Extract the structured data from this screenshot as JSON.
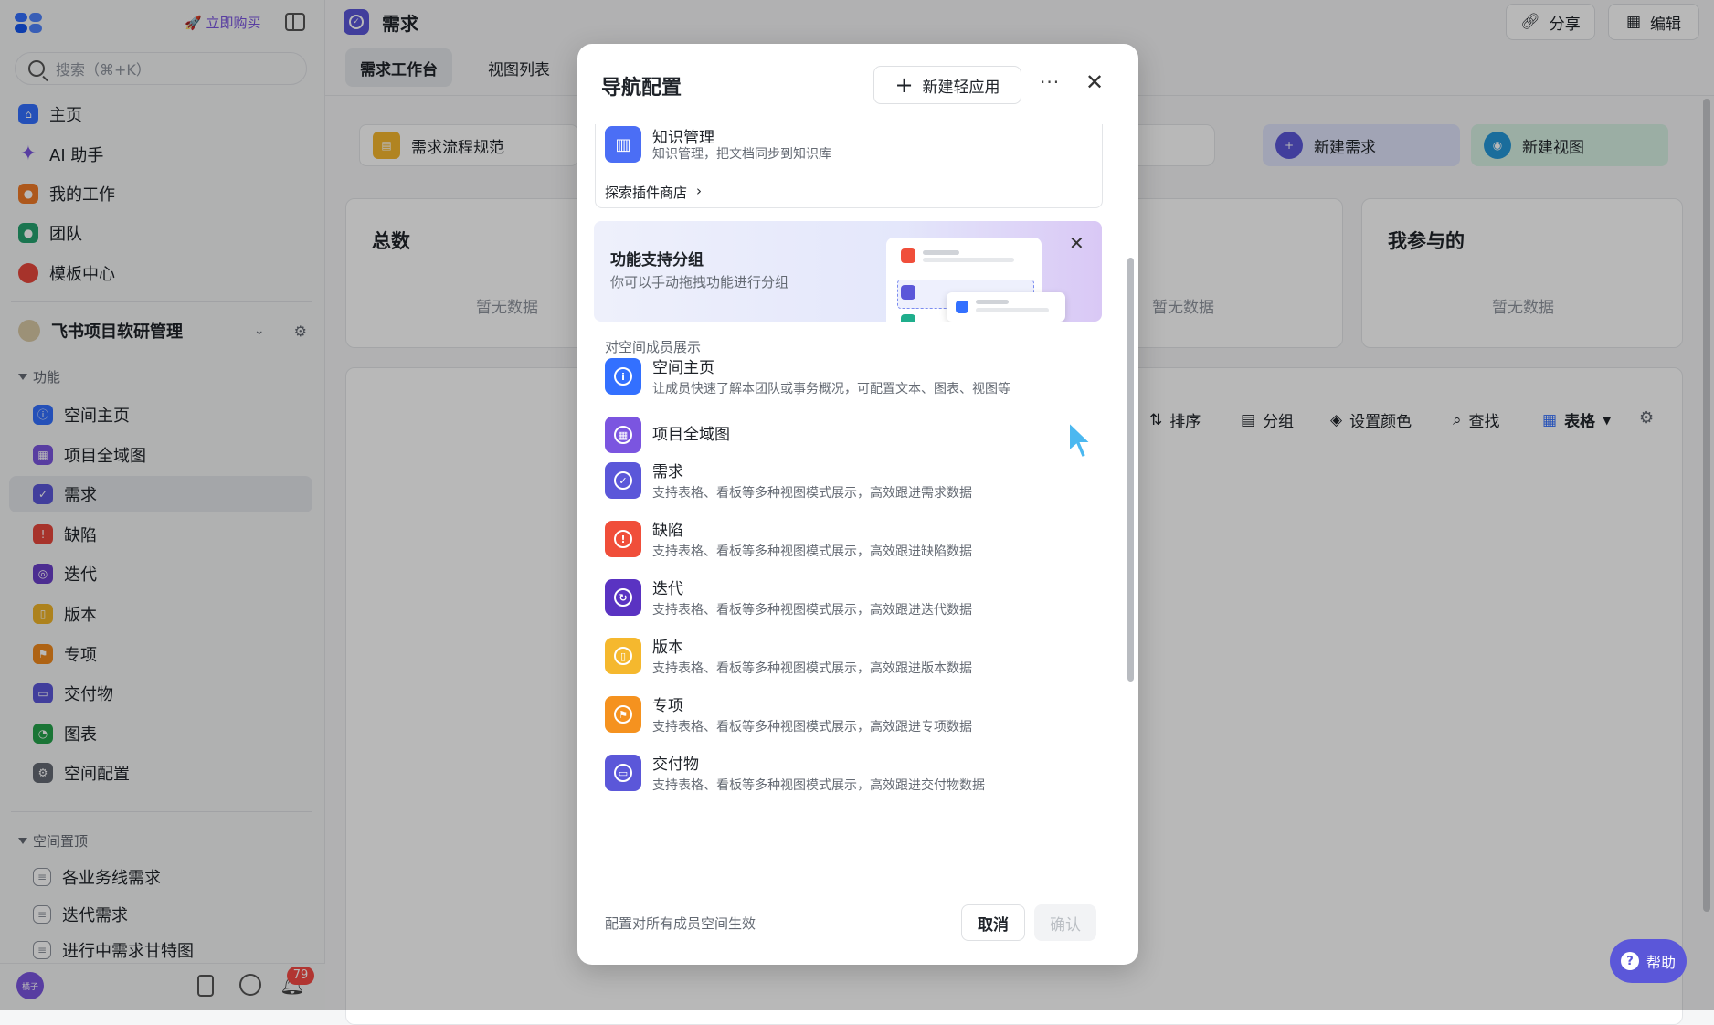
{
  "sidebar": {
    "buy_label": "立即购买",
    "search_placeholder": "搜索（⌘+K）",
    "nav": [
      {
        "label": "主页",
        "icon": "home-icon",
        "color": "#3370ff"
      },
      {
        "label": "AI 助手",
        "icon": "sparkle-icon",
        "color": "#7b55e0"
      },
      {
        "label": "我的工作",
        "icon": "person-icon",
        "color": "#f07b28"
      },
      {
        "label": "团队",
        "icon": "team-icon",
        "color": "#25a36f"
      },
      {
        "label": "模板中心",
        "icon": "template-icon",
        "color": "#e8473c"
      }
    ],
    "space_name": "飞书项目软研管理",
    "section_function": "功能",
    "functions": [
      {
        "label": "空间主页",
        "icon": "info-icon",
        "color": "#3370ff"
      },
      {
        "label": "项目全域图",
        "icon": "grid-icon",
        "color": "#7b55e0"
      },
      {
        "label": "需求",
        "icon": "check-circle-icon",
        "color": "#5b57d9"
      },
      {
        "label": "缺陷",
        "icon": "alert-icon",
        "color": "#e8473c"
      },
      {
        "label": "迭代",
        "icon": "cycle-icon",
        "color": "#6a3fc9"
      },
      {
        "label": "版本",
        "icon": "bookmark-icon",
        "color": "#f0b429"
      },
      {
        "label": "专项",
        "icon": "flag-icon",
        "color": "#f28a1c"
      },
      {
        "label": "交付物",
        "icon": "folder-icon",
        "color": "#5b57d9"
      },
      {
        "label": "图表",
        "icon": "chart-icon",
        "color": "#25a34b"
      },
      {
        "label": "空间配置",
        "icon": "settings-icon",
        "color": "#646a73"
      }
    ],
    "section_pinned": "空间置顶",
    "pinned": [
      {
        "label": "各业务线需求"
      },
      {
        "label": "迭代需求"
      },
      {
        "label": "进行中需求甘特图"
      }
    ],
    "avatar_text": "橘子",
    "notification_count": "79"
  },
  "main": {
    "title": "需求",
    "tabs": [
      "需求工作台",
      "视图列表"
    ],
    "share_label": "分享",
    "edit_label": "编辑",
    "flow_label": "需求流程规范",
    "new_requirement": "新建需求",
    "new_view": "新建视图",
    "stats": [
      {
        "title": "总数",
        "empty": "暂无数据"
      },
      {
        "title": "",
        "empty": "暂无数据"
      },
      {
        "title": "我参与的",
        "empty": "暂无数据"
      }
    ],
    "toolbar": [
      "排序",
      "分组",
      "设置颜色",
      "查找",
      "表格"
    ],
    "help_label": "帮助"
  },
  "modal": {
    "title": "导航配置",
    "new_app_label": "新建轻应用",
    "knowledge": {
      "title": "知识管理",
      "desc": "知识管理，把文档同步到知识库"
    },
    "explore_label": "探索插件商店",
    "banner": {
      "title": "功能支持分组",
      "desc": "你可以手动拖拽功能进行分组"
    },
    "section_label": "对空间成员展示",
    "items": [
      {
        "title": "空间主页",
        "desc": "让成员快速了解本团队或事务概况，可配置文本、图表、视图等",
        "color": "#3370ff",
        "glyph": "i"
      },
      {
        "title": "项目全域图",
        "desc": "",
        "color": "#7b55e0",
        "glyph": "▦"
      },
      {
        "title": "需求",
        "desc": "支持表格、看板等多种视图模式展示，高效跟进需求数据",
        "color": "#5b57d9",
        "glyph": "✓"
      },
      {
        "title": "缺陷",
        "desc": "支持表格、看板等多种视图模式展示，高效跟进缺陷数据",
        "color": "#f04e3a",
        "glyph": "!"
      },
      {
        "title": "迭代",
        "desc": "支持表格、看板等多种视图模式展示，高效跟进迭代数据",
        "color": "#5a33c2",
        "glyph": "↻"
      },
      {
        "title": "版本",
        "desc": "支持表格、看板等多种视图模式展示，高效跟进版本数据",
        "color": "#f5b82e",
        "glyph": "▯"
      },
      {
        "title": "专项",
        "desc": "支持表格、看板等多种视图模式展示，高效跟进专项数据",
        "color": "#f5921f",
        "glyph": "⚑"
      },
      {
        "title": "交付物",
        "desc": "支持表格、看板等多种视图模式展示，高效跟进交付物数据",
        "color": "#5b57d9",
        "glyph": "▭"
      }
    ],
    "footer_note": "配置对所有成员空间生效",
    "cancel_label": "取消",
    "confirm_label": "确认"
  }
}
